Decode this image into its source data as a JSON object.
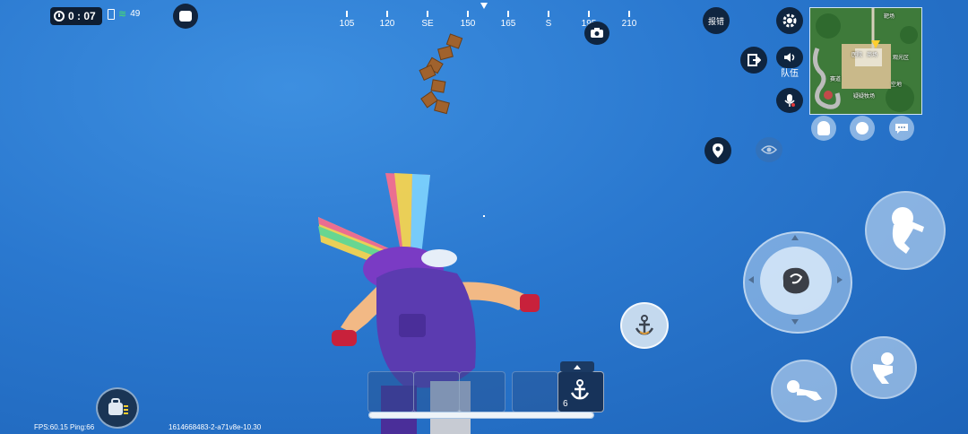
{
  "hud": {
    "timer": "0 : 07",
    "signal": "49",
    "fps_ping": "FPS:60.15 Ping:66",
    "session_id": "1614668483-2-a71v8e-10.30"
  },
  "compass": {
    "marks": [
      "105",
      "120",
      "SE",
      "150",
      "165",
      "S",
      "195",
      "210"
    ]
  },
  "right_panel": {
    "report_label": "报错",
    "team_label": "队伍"
  },
  "minimap": {
    "labels": [
      "靶场",
      "商场",
      "医院",
      "观光区",
      "赛道",
      "空地",
      "疑疑牧场"
    ]
  },
  "hotbar": {
    "selected_count": "6",
    "progress": 1.0
  },
  "colors": {
    "sky": "#2a78cf",
    "hud_dark": "#0f2540"
  },
  "icons": [
    "clock-icon",
    "battery-icon",
    "wifi-icon",
    "camera-icon",
    "settings-icon",
    "exit-icon",
    "speaker-icon",
    "mic-icon",
    "location-pin-icon",
    "eye-icon",
    "anchor-icon",
    "backpack-icon",
    "chat-icon",
    "emote-icon"
  ]
}
